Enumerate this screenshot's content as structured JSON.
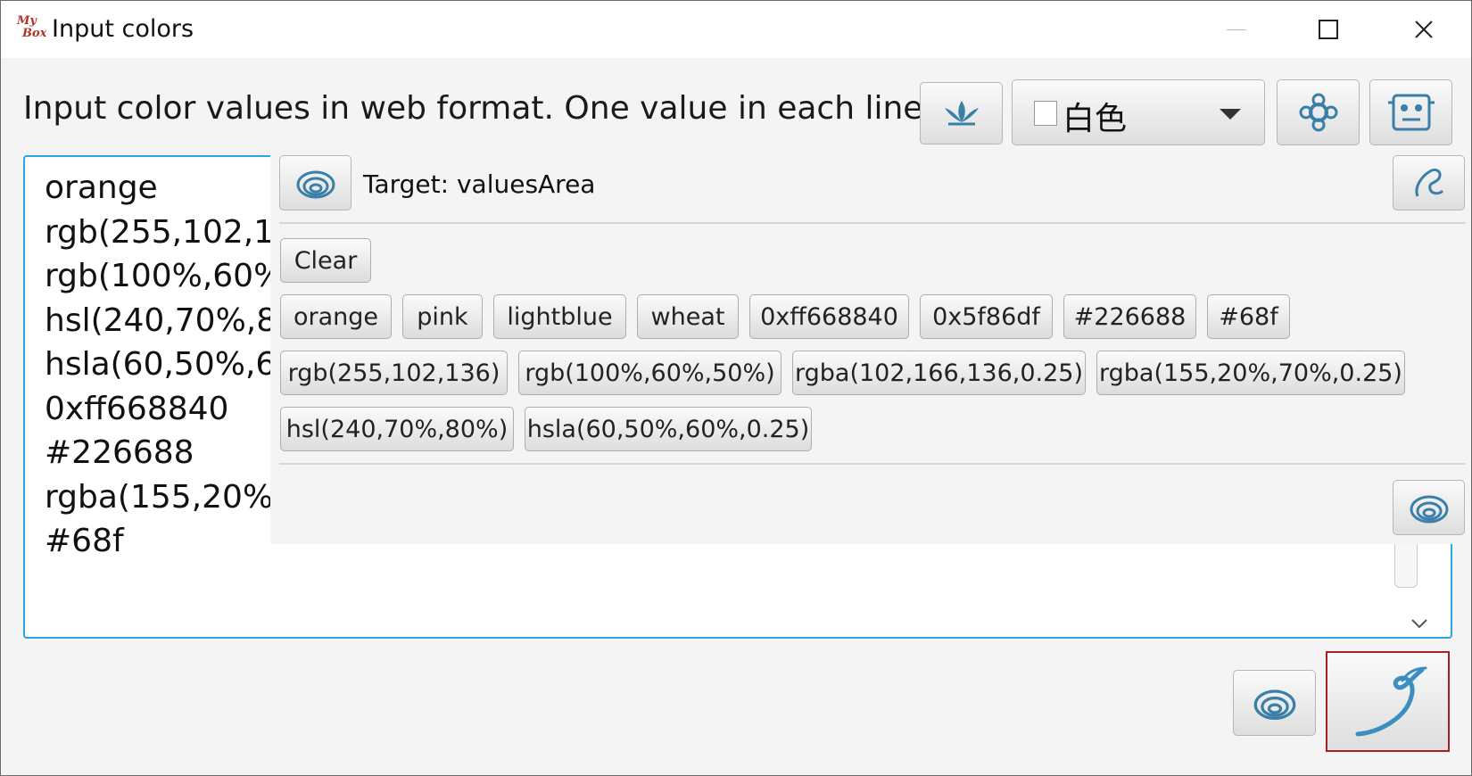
{
  "window": {
    "title": "Input colors",
    "logo_text_top": "My",
    "logo_text_bottom": "Box"
  },
  "prompt": "Input color values in web format. One value in each line.",
  "toolbar": {
    "select_value": "白色"
  },
  "values_area": {
    "lines": [
      "orange",
      "rgb(255,102,13",
      "rgb(100%,60%,",
      "hsl(240,70%,80",
      "hsla(60,50%,60",
      "0xff668840",
      "#226688",
      "rgba(155,20%,7",
      "#68f"
    ]
  },
  "popup": {
    "target_label": "Target: valuesArea",
    "clear_label": "Clear",
    "chips_row1": [
      "orange",
      "pink",
      "lightblue",
      "wheat",
      "0xff668840",
      "0x5f86df",
      "#226688",
      "#68f"
    ],
    "chips_row2": [
      "rgb(255,102,136)",
      "rgb(100%,60%,50%)",
      "rgba(102,166,136,0.25)",
      "rgba(155,20%,70%,0.25)"
    ],
    "chips_row3": [
      "hsl(240,70%,80%)",
      "hsla(60,50%,60%,0.25)"
    ]
  },
  "colors": {
    "accent_blue": "#2aa6e0",
    "icon_blue": "#3a7fa8",
    "focus_red": "#a32224"
  }
}
